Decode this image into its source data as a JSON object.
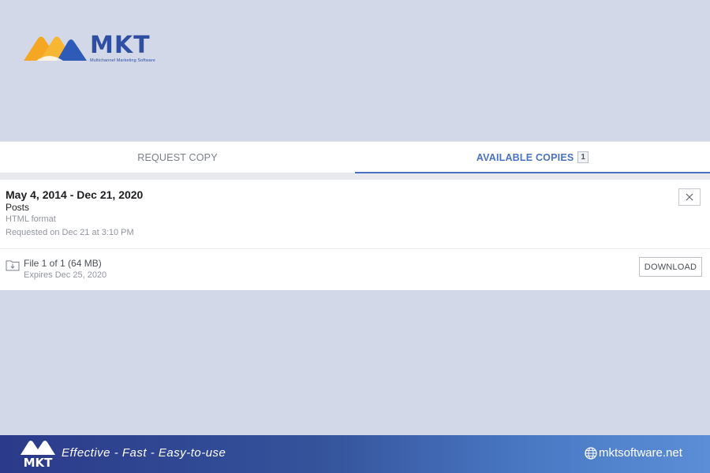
{
  "brand": {
    "logo_title": "MKT",
    "logo_subtitle": "Multichannel Marketing Software"
  },
  "tabs": [
    {
      "label": "REQUEST COPY",
      "active": false
    },
    {
      "label": "AVAILABLE COPIES",
      "active": true,
      "count": "1"
    }
  ],
  "copy": {
    "date_range": "May 4, 2014 - Dec 21, 2020",
    "content_type": "Posts",
    "format": "HTML format",
    "requested": "Requested on Dec 21 at 3:10 PM",
    "file": {
      "info": "File 1 of 1 (64 MB)",
      "expires": "Expires Dec 25, 2020",
      "download_label": "DOWNLOAD"
    }
  },
  "footer": {
    "logo_text": "MKT",
    "tagline": "Effective - Fast - Easy-to-use",
    "website": "mktsoftware.net"
  },
  "colors": {
    "background": "#d3d8e8",
    "accent": "#4a72c2",
    "brand_blue": "#2f4fa3",
    "brand_orange": "#f5a623"
  },
  "icons": [
    "close-icon",
    "file-download-icon",
    "globe-icon"
  ]
}
